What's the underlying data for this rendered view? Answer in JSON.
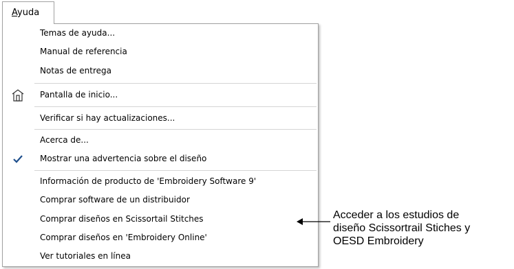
{
  "menubar": {
    "menu_mnemonic": "A",
    "menu_rest": "yuda"
  },
  "menu": {
    "items": [
      {
        "label": "Temas de ayuda..."
      },
      {
        "label": "Manual de referencia"
      },
      {
        "label": "Notas de entrega"
      },
      {
        "label": "Pantalla de inicio...",
        "icon": "home-screen-icon"
      },
      {
        "label": "Verificar si hay actualizaciones..."
      },
      {
        "label": "Acerca de..."
      },
      {
        "label": "Mostrar una advertencia sobre el diseño",
        "checked": true,
        "icon": "checkmark-icon"
      },
      {
        "label": "Información de producto de 'Embroidery Software 9'"
      },
      {
        "label": "Comprar software de un distribuidor"
      },
      {
        "label": "Comprar diseños en Scissortail Stitches"
      },
      {
        "label": "Comprar diseños en 'Embroidery Online'"
      },
      {
        "label": "Ver tutoriales en línea"
      }
    ]
  },
  "callout": {
    "lines": [
      "Acceder a los estudios de",
      "diseño Scissortrail Stiches y",
      "OESD Embroidery"
    ],
    "icon": "left-arrow-icon"
  },
  "colors": {
    "border": "#a0a0a0",
    "separator": "#d4d4d4",
    "check": "#1e4f8c"
  }
}
